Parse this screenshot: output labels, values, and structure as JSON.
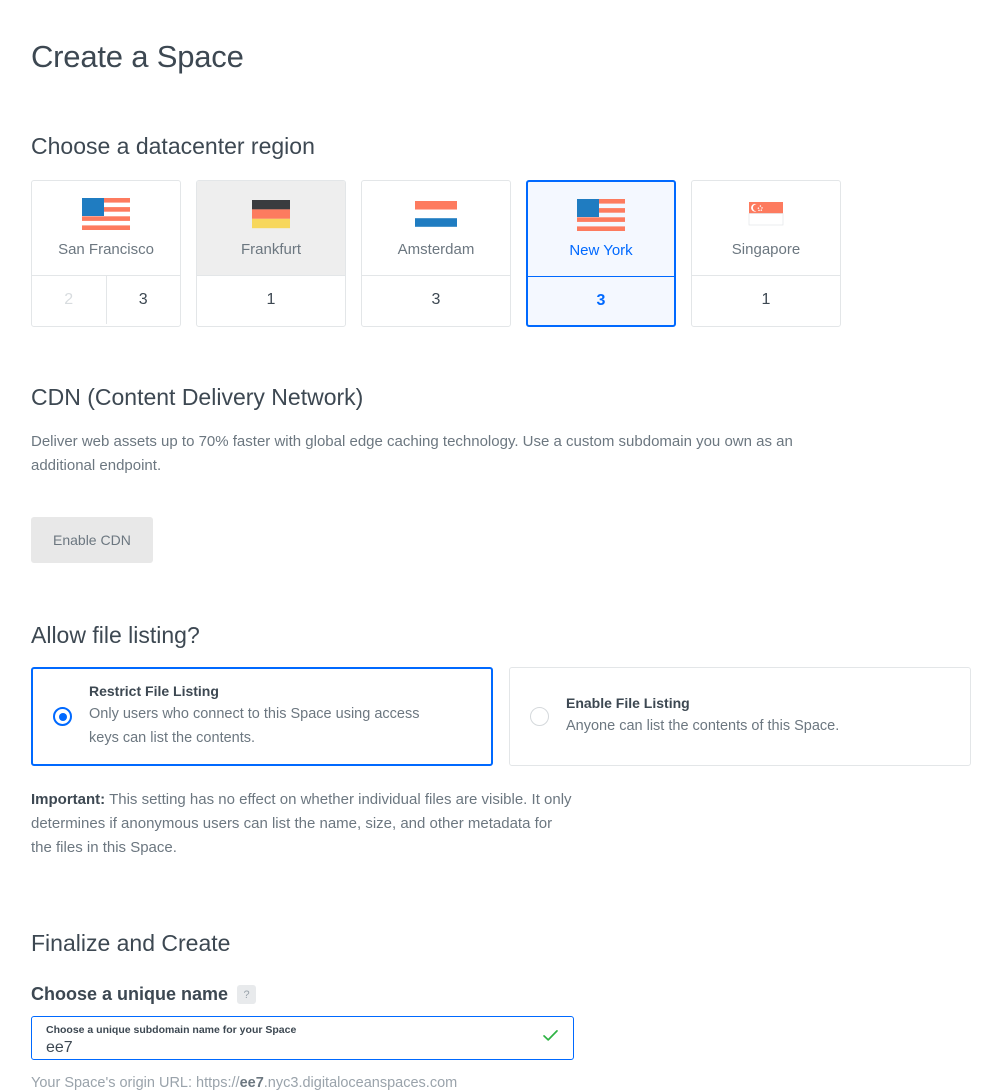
{
  "page": {
    "title": "Create a Space"
  },
  "region_section": {
    "heading": "Choose a datacenter region",
    "cards": [
      {
        "name": "San Francisco",
        "flag": "us-flag-icon",
        "state": "default",
        "slots": [
          {
            "label": "2",
            "disabled": true
          },
          {
            "label": "3",
            "disabled": false
          }
        ]
      },
      {
        "name": "Frankfurt",
        "flag": "de-flag-icon",
        "state": "hovered",
        "slots": [
          {
            "label": "1",
            "disabled": false
          }
        ]
      },
      {
        "name": "Amsterdam",
        "flag": "nl-flag-icon",
        "state": "default",
        "slots": [
          {
            "label": "3",
            "disabled": false
          }
        ]
      },
      {
        "name": "New York",
        "flag": "us-flag-icon",
        "state": "selected",
        "slots": [
          {
            "label": "3",
            "disabled": false
          }
        ]
      },
      {
        "name": "Singapore",
        "flag": "sg-flag-icon",
        "state": "default",
        "slots": [
          {
            "label": "1",
            "disabled": false
          }
        ]
      }
    ]
  },
  "cdn_section": {
    "heading": "CDN (Content Delivery Network)",
    "description": "Deliver web assets up to 70% faster with global edge caching technology. Use a custom subdomain you own as an additional endpoint.",
    "button_label": "Enable CDN"
  },
  "listing_section": {
    "heading": "Allow file listing?",
    "options": [
      {
        "title": "Restrict File Listing",
        "description": "Only users who connect to this Space using access keys can list the contents.",
        "selected": true
      },
      {
        "title": "Enable File Listing",
        "description": "Anyone can list the contents of this Space.",
        "selected": false
      }
    ],
    "note_label": "Important:",
    "note_text": " This setting has no effect on whether individual files are visible. It only determines if anonymous users can list the name, size, and other metadata for the files in this Space."
  },
  "finalize_section": {
    "heading": "Finalize and Create",
    "field_label": "Choose a unique name",
    "help_badge": "?",
    "input_inner_label": "Choose a unique subdomain name for your Space",
    "input_value": "ee7",
    "input_placeholder": "Choose a unique subdomain name for your Space",
    "valid_icon": "check-icon",
    "origin_prefix": "Your Space's origin URL: https://",
    "origin_name": "ee7",
    "origin_suffix": ".nyc3.digitaloceanspaces.com"
  },
  "colors": {
    "accent": "#0069ff",
    "accent_bg": "#f4f8ff",
    "flag_red": "#fd7b5f",
    "flag_blue": "#1f7cc1",
    "flag_yellow": "#f7d košice"
  }
}
